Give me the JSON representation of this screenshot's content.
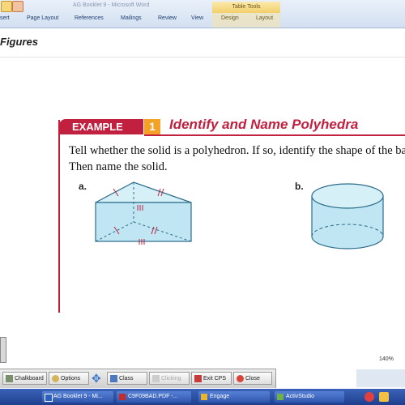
{
  "window": {
    "title": "AG Booklet 9 - Microsoft Word",
    "context_tab_group": "Table Tools"
  },
  "ribbon_tabs": [
    "sert",
    "Page Layout",
    "References",
    "Mailings",
    "Review",
    "View",
    "Design",
    "Layout"
  ],
  "document": {
    "section_heading": "Figures",
    "example": {
      "tag": "EXAMPLE",
      "number": "1",
      "title": "Identify and Name Polyhedra",
      "instruction": "Tell whether the solid is a polyhedron. If so, identify the shape of the bases. Then name the solid.",
      "part_a": "a.",
      "part_b": "b."
    }
  },
  "presenter_toolbar": {
    "chalkboard": "Chalkboard",
    "options": "Options",
    "class": "Class",
    "clicking": "Clicking",
    "exit_cps": "Exit CPS",
    "close": "Close"
  },
  "status": {
    "zoom": "140%"
  },
  "taskbar": {
    "items": [
      "AG Booklet 9 - Mi...",
      "C9F09BAD.PDF -...",
      "Engage",
      "ActivStudio"
    ]
  },
  "colors": {
    "accent_red": "#c1203e",
    "accent_orange": "#f3a127",
    "solid_fill": "#bfe6f2",
    "taskbar_blue": "#2a4fa8"
  }
}
